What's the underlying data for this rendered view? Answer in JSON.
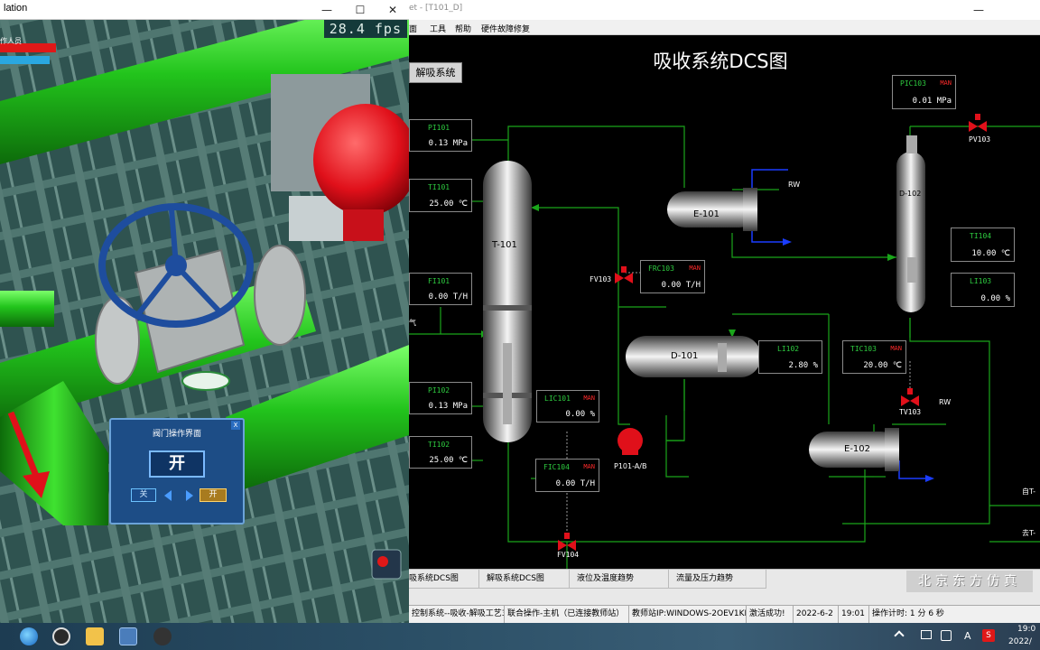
{
  "sim_window": {
    "title": "lation",
    "minimize": "—",
    "maximize": "☐",
    "close": "✕",
    "fps": "28.4 fps",
    "hud_label": "作人员",
    "valve_panel": {
      "title": "阀门操作界面",
      "state": "开",
      "close_btn": "关",
      "open_btn": "开",
      "corner": "X"
    }
  },
  "dcs_window": {
    "title": "et - [T101_D]",
    "menu": [
      "面",
      "工具",
      "帮助",
      "硬件故障修复"
    ],
    "diagram_title": "吸收系统DCS图",
    "desorb_button": "解吸系统",
    "equipment": {
      "t101": "T-101",
      "e101": "E-101",
      "d101": "D-101",
      "d102": "D-102",
      "e102": "E-102",
      "pump": "P101-A/B"
    },
    "tags": {
      "pi101": {
        "name": "PI101",
        "value": "0.13  MPa"
      },
      "ti101": {
        "name": "TI101",
        "value": "25.00  ℃"
      },
      "fi101": {
        "name": "FI101",
        "value": "0.00  T/H"
      },
      "pi102": {
        "name": "PI102",
        "value": "0.13  MPa"
      },
      "ti102": {
        "name": "TI102",
        "value": "25.00  ℃"
      },
      "lic101": {
        "name": "LIC101",
        "man": "MAN",
        "value": "0.00  %"
      },
      "fic104": {
        "name": "FIC104",
        "man": "MAN",
        "value": "0.00  T/H"
      },
      "frc103": {
        "name": "FRC103",
        "man": "MAN",
        "value": "0.00  T/H"
      },
      "li102": {
        "name": "LI102",
        "value": "2.80  %"
      },
      "tic103": {
        "name": "TIC103",
        "man": "MAN",
        "value": "20.00  ℃"
      },
      "pic103": {
        "name": "PIC103",
        "man": "MAN",
        "value": "0.01  MPa"
      },
      "ti104": {
        "name": "TI104",
        "value": "10.00  ℃"
      },
      "li103": {
        "name": "LI103",
        "value": "0.00  %"
      }
    },
    "valves": {
      "fv103": "FV103",
      "fv104": "FV104",
      "tv103": "TV103",
      "pv103": "PV103"
    },
    "side_labels": {
      "rw1": "RW",
      "rw2": "RW",
      "gas": "气",
      "from_t": "自T-",
      "to_t": "去T-"
    },
    "tabs": [
      "吸系统DCS图",
      "解吸系统DCS图",
      "液位及温度趋势",
      "流量及压力趋势"
    ],
    "brand": "北京东方仿真",
    "status": [
      "控制系统--吸收-解吸工艺3D",
      "联合操作-主机（已连接教师站）",
      "教师站IP:WINDOWS-2OEV1KI",
      "激活成功!",
      "2022-6-2",
      "19:01",
      "操作计时: 1 分 6 秒"
    ]
  },
  "taskbar": {
    "clock_time": "19:0",
    "clock_date": "2022/",
    "lang": "A",
    "ime": "S"
  },
  "colors": {
    "pipe_green": "#22c41c",
    "valve_red": "#e0101a",
    "flow_line": "#1aa51a",
    "flow_arrow_blue": "#1a3cff",
    "tag_green": "#2ecc40",
    "man_red": "#ff2a2a"
  }
}
